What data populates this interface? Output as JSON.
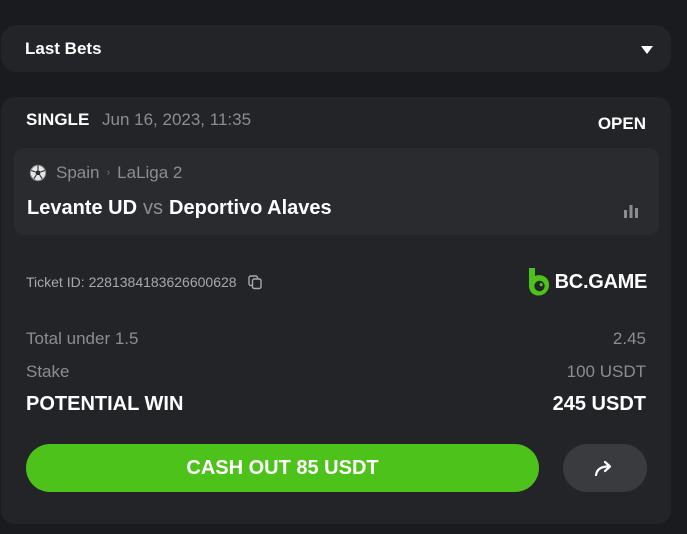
{
  "header": {
    "title": "Last Bets"
  },
  "bet": {
    "type": "SINGLE",
    "date": "Jun 16, 2023, 11:35",
    "status": "OPEN",
    "country": "Spain",
    "league": "LaLiga 2",
    "home_team": "Levante UD",
    "vs": "vs",
    "away_team": "Deportivo Alaves",
    "ticket_label": "Ticket ID:",
    "ticket_id": "2281384183626600628",
    "brand": "BC.GAME",
    "selection": "Total under 1.5",
    "odds": "2.45",
    "stake_label": "Stake",
    "stake_value": "100 USDT",
    "potential_label": "POTENTIAL WIN",
    "potential_value": "245 USDT",
    "cashout_label": "CASH OUT 85 USDT"
  },
  "icons": {
    "dropdown": "chevron-down-icon",
    "sport": "soccer-ball-icon",
    "separator": "chevron-right-icon",
    "stats": "bar-chart-icon",
    "copy": "copy-icon",
    "brand": "bc-game-logo",
    "share": "share-arrow-icon"
  },
  "colors": {
    "background": "#1a1b1e",
    "card": "#232427",
    "accent_green": "#4dc21a",
    "muted_text": "#8b8d91"
  }
}
